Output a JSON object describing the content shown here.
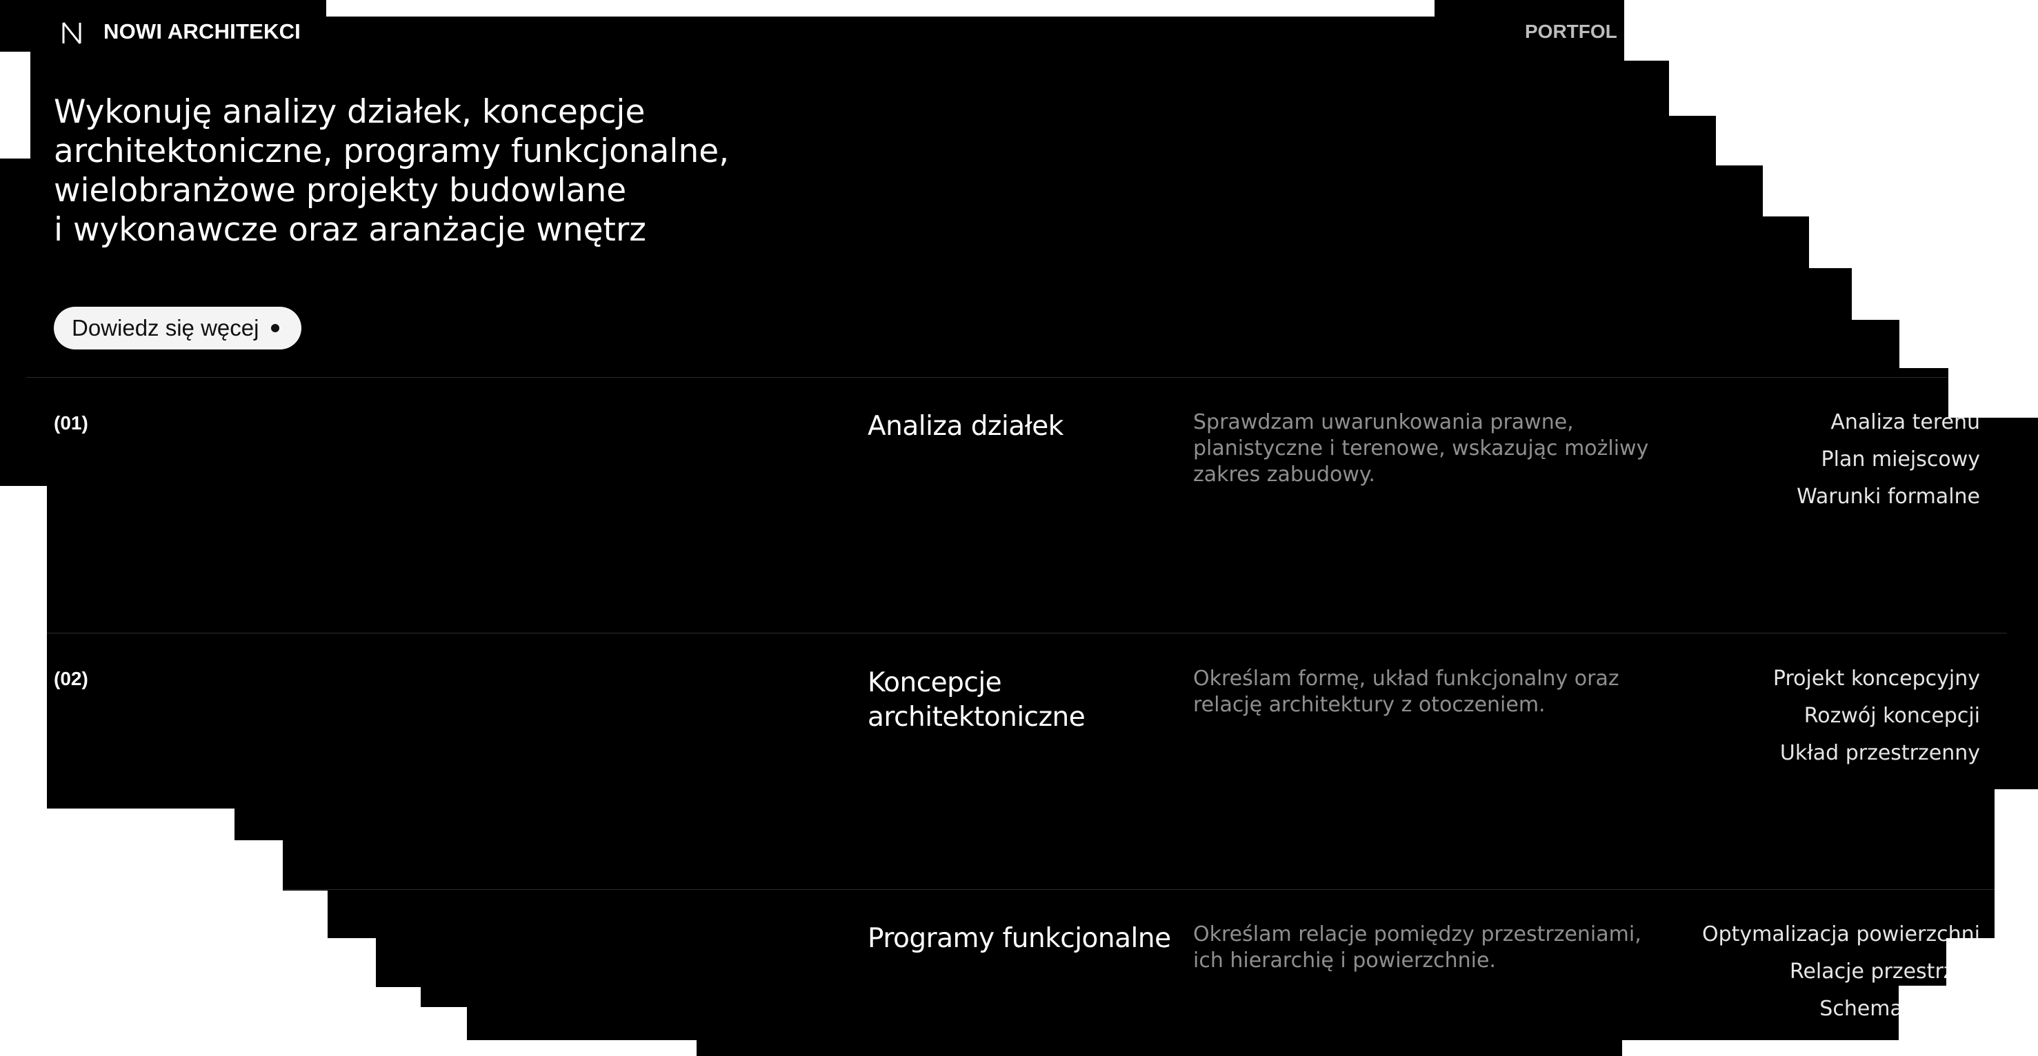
{
  "header": {
    "brand": "NOWI ARCHITEKCI",
    "nav_item": "PORTFOL"
  },
  "intro": {
    "lines": [
      "Wykonuję analizy działek, koncepcje",
      "architektoniczne, programy funkcjonalne,",
      "wielobranżowe projekty budowlane",
      "i wykonawcze oraz aranżacje wnętrz"
    ],
    "cta_label": "Dowiedz się węcej"
  },
  "services": [
    {
      "number": "(01)",
      "title_lines": [
        "Analiza działek"
      ],
      "description_lines": [
        "Sprawdzam uwarunkowania prawne,",
        "planistyczne i terenowe, wskazując możliwy",
        "zakres zabudowy."
      ],
      "tags": [
        "Analiza terenu",
        "Plan miejscowy",
        "Warunki formalne"
      ]
    },
    {
      "number": "(02)",
      "title_lines": [
        "Koncepcje",
        "architektoniczne"
      ],
      "description_lines": [
        "Określam formę, układ funkcjonalny oraz",
        "relację architektury z otoczeniem."
      ],
      "tags": [
        "Projekt koncepcyjny",
        "Rozwój koncepcji",
        "Układ przestrzenny"
      ]
    },
    {
      "number": "",
      "title_lines": [
        "Programy funkcjonalne"
      ],
      "description_lines": [
        "Określam relacje pomiędzy przestrzeniami,",
        "ich hierarchię i powierzchnie."
      ],
      "tags": [
        "Optymalizacja powierzchni",
        "Relacje przestrzen",
        "Schemat funkcj"
      ]
    }
  ],
  "colors": {
    "background": "#000000",
    "page_outside": "#ffffff",
    "text_primary": "#ffffff",
    "text_muted": "#8f8f8f",
    "cta_background": "#f4f4f4",
    "divider": "#2c2c2c"
  }
}
